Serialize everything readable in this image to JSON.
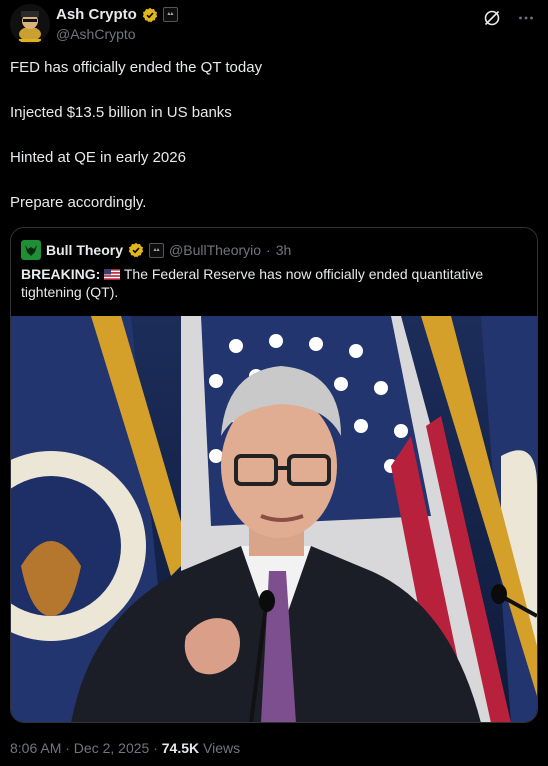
{
  "author": {
    "name": "Ash Crypto",
    "handle": "@AshCrypto"
  },
  "tweet": {
    "lines": [
      "FED has officially ended the QT today",
      "Injected $13.5 billion in US banks",
      "Hinted at QE in early 2026",
      "Prepare accordingly."
    ]
  },
  "quote": {
    "name": "Bull Theory",
    "handle": "@BullTheoryio",
    "separator": "·",
    "time": "3h",
    "breaking_label": "BREAKING:",
    "text": " The Federal Reserve has now officially ended quantitative tightening (QT).",
    "image_alt": "Federal Reserve chair speaking at a podium in front of flags"
  },
  "footer": {
    "time": "8:06 AM · Dec 2, 2025 · ",
    "views_count": "74.5K",
    "views_label": " Views"
  },
  "colors": {
    "verified": "#e2b719",
    "link_gray": "#71767b",
    "border": "#2f3336"
  }
}
